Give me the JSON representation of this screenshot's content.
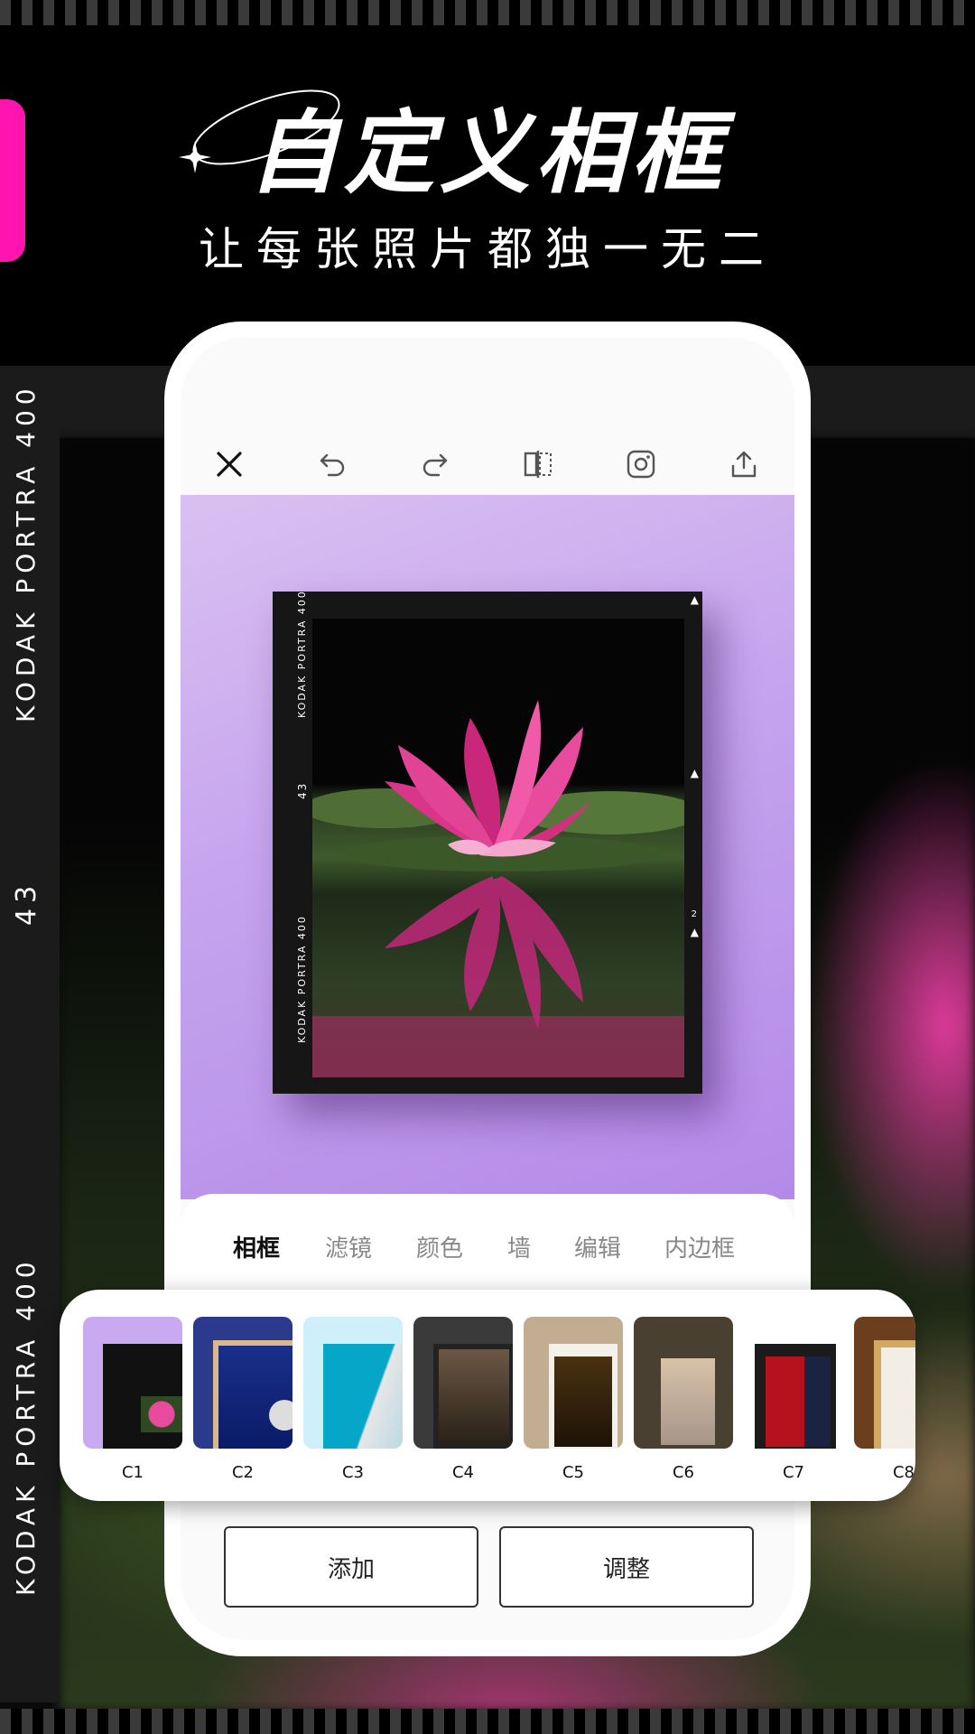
{
  "hero": {
    "title": "自定义相框",
    "subtitle": "让每张照片都独一无二"
  },
  "film_strip": {
    "top_label": "KODAK  PORTRA 400",
    "frame_number": "43",
    "bottom_label": "KODAK  PORTRA 400"
  },
  "toolbar": {
    "icons": [
      "close-icon",
      "undo-icon",
      "redo-icon",
      "flip-icon",
      "instagram-icon",
      "share-icon"
    ]
  },
  "frame_preview": {
    "label_top": "KODAK  PORTRA 400",
    "label_mid": "43",
    "label_bottom": "KODAK  PORTRA 400",
    "mark": "2"
  },
  "tabs": [
    {
      "label": "相框",
      "active": true
    },
    {
      "label": "滤镜",
      "active": false
    },
    {
      "label": "颜色",
      "active": false
    },
    {
      "label": "墙",
      "active": false
    },
    {
      "label": "编辑",
      "active": false
    },
    {
      "label": "内边框",
      "active": false
    }
  ],
  "frames": [
    {
      "label": "C1"
    },
    {
      "label": "C2"
    },
    {
      "label": "C3"
    },
    {
      "label": "C4"
    },
    {
      "label": "C5"
    },
    {
      "label": "C6"
    },
    {
      "label": "C7"
    },
    {
      "label": "C8"
    }
  ],
  "actions": {
    "add_label": "添加",
    "adjust_label": "调整"
  },
  "colors": {
    "accent_pink": "#ff14b0",
    "canvas_purple": "#c5a3ee"
  }
}
